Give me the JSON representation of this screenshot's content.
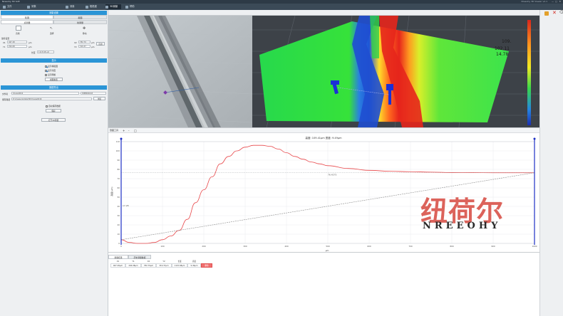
{
  "app": {
    "title": "Nreeohy 3D Soft",
    "right_status": "Nreeohy 3D Viewer  v2.1",
    "window_controls": [
      "—",
      "□",
      "✕"
    ]
  },
  "toolbar": {
    "items": [
      {
        "label": "文件",
        "icon": "file-icon"
      },
      {
        "label": "采集",
        "icon": "camera-icon"
      },
      {
        "label": "测量",
        "icon": "ruler-icon"
      },
      {
        "label": "粗糙度",
        "icon": "surface-icon"
      },
      {
        "label": "3D测量",
        "icon": "cube-icon",
        "active": true
      },
      {
        "label": "帮助",
        "icon": "help-icon"
      }
    ]
  },
  "left": {
    "section1": "测量设置",
    "tabs": [
      "轮廓",
      "截面"
    ],
    "tabs2": [
      "点测量",
      "线测量"
    ],
    "tools": [
      "直线",
      "选择",
      "移动"
    ],
    "coord_title": "坐标设置",
    "fields": [
      {
        "label": "X1",
        "value": "467.28",
        "unit": "μm"
      },
      {
        "label": "Y1",
        "value": "294.08",
        "unit": "μm"
      },
      {
        "label": "X2",
        "value": "782.79",
        "unit": "μm"
      },
      {
        "label": "Y2",
        "value": "319.37",
        "unit": "μm"
      }
    ],
    "apply": "应用",
    "length_label": "长度",
    "length_value": "1115.68 μm",
    "section2": "显示",
    "options": [
      {
        "label": "显示横截面",
        "checked": true
      },
      {
        "label": "显示刻度",
        "checked": true
      },
      {
        "label": "显示网格",
        "checked": false
      }
    ],
    "reset": "视图重置",
    "section3": "数据导出",
    "export_label": "文件名",
    "export_value": "Image0016",
    "export_hint": "测量数据存储",
    "path_label": "保存路径",
    "path_value": "D:\\measure\\data\\3D\\Image0016",
    "browse": "浏览",
    "auto_label": "自动保存数据",
    "save": "保存",
    "open": "打开3D测量"
  },
  "view3d": {
    "labels": [
      "109.",
      "102.11",
      "14.78"
    ]
  },
  "chart_toolbar": [
    "剖面工具",
    "+",
    "-",
    "□"
  ],
  "chart_data": {
    "type": "line",
    "title": "高度: 109.41μm 宽度: 9.49μm",
    "xlabel": "μm",
    "ylabel": "高度(μm)",
    "xlim": [
      0,
      1000
    ],
    "ylim": [
      0,
      110
    ],
    "x_ticks": [
      0,
      100,
      200,
      300,
      400,
      500,
      600,
      700,
      800,
      900,
      1000
    ],
    "y_ticks": [
      0,
      10,
      20,
      30,
      40,
      50,
      60,
      70,
      80,
      90,
      100,
      110
    ],
    "ref_line_label": "76.4275",
    "left_marker_label": "17.28",
    "series": [
      {
        "color": "#e8474a",
        "x": [
          0,
          20,
          40,
          60,
          80,
          100,
          120,
          140,
          160,
          180,
          200,
          220,
          240,
          260,
          280,
          300,
          320,
          340,
          360,
          380,
          400,
          420,
          440,
          460,
          480,
          500,
          550,
          600,
          650,
          700,
          750,
          800,
          850,
          900,
          950,
          1000
        ],
        "values": [
          4,
          1,
          0,
          0,
          1,
          4,
          8,
          14,
          26,
          44,
          58,
          72,
          86,
          94,
          100,
          104,
          106,
          106,
          105,
          102,
          98,
          94,
          91,
          88,
          86,
          84,
          81,
          79,
          78,
          77.5,
          77,
          76.6,
          76.5,
          76.4,
          76.4,
          76.4
        ]
      },
      {
        "color": "#8c8c8c",
        "dashed": true,
        "x": [
          0,
          1000
        ],
        "values": [
          4,
          76.4
        ]
      }
    ],
    "cursors": [
      0,
      1000
    ]
  },
  "bottom": {
    "tabs": [
      "测量结果",
      "历史测量数据"
    ],
    "headers": [
      "X1",
      "Y1",
      "X2",
      "Y2",
      "长度",
      "高度"
    ],
    "row": [
      "467.28μm",
      "294.08μm",
      "782.79μm",
      "319.37μm",
      "1115.68μm",
      "9.49μm"
    ],
    "delete": "删除"
  },
  "watermark": {
    "cn": "纽荷尔",
    "en": "NREEOHY"
  }
}
